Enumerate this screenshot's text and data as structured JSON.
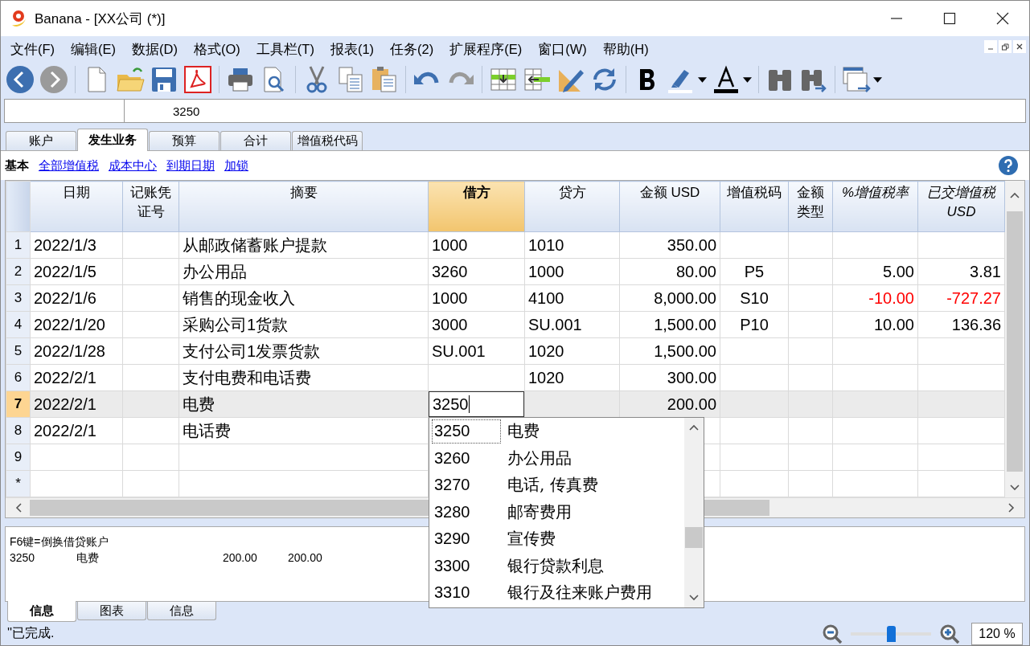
{
  "window": {
    "title": "Banana - [XX公司 (*)]"
  },
  "menu": [
    "文件(F)",
    "编辑(E)",
    "数据(D)",
    "格式(O)",
    "工具栏(T)",
    "报表(1)",
    "任务(2)",
    "扩展程序(E)",
    "窗口(W)",
    "帮助(H)"
  ],
  "formula_bar": {
    "value": "3250"
  },
  "tabs": [
    {
      "label": "账户",
      "selected": false
    },
    {
      "label": "发生业务",
      "selected": true
    },
    {
      "label": "预算",
      "selected": false
    },
    {
      "label": "合计",
      "selected": false
    },
    {
      "label": "增值税代码",
      "selected": false
    }
  ],
  "views": [
    {
      "label": "基本",
      "selected": true
    },
    {
      "label": "全部增值税",
      "selected": false
    },
    {
      "label": "成本中心",
      "selected": false
    },
    {
      "label": "到期日期",
      "selected": false
    },
    {
      "label": "加锁",
      "selected": false
    }
  ],
  "table": {
    "columns": [
      {
        "label": "日期",
        "kind": "text",
        "italic": false,
        "selected": false
      },
      {
        "label": "记账凭证号",
        "kind": "text",
        "italic": false,
        "selected": false
      },
      {
        "label": "摘要",
        "kind": "text",
        "italic": false,
        "selected": false
      },
      {
        "label": "借方",
        "kind": "text",
        "italic": false,
        "selected": true
      },
      {
        "label": "贷方",
        "kind": "text",
        "italic": false,
        "selected": false
      },
      {
        "label": "金额 USD",
        "kind": "amount",
        "italic": false,
        "selected": false
      },
      {
        "label": "增值税码",
        "kind": "code",
        "italic": false,
        "selected": false
      },
      {
        "label": "金额类型",
        "kind": "code",
        "italic": false,
        "selected": false
      },
      {
        "label": "%增值税率",
        "kind": "amount",
        "italic": true,
        "selected": false
      },
      {
        "label": "已交增值税 USD",
        "kind": "amount",
        "italic": true,
        "selected": false
      }
    ],
    "rows": [
      {
        "number": "1",
        "selected": false,
        "editing": false,
        "cells": [
          "2022/1/3",
          null,
          "从邮政储蓄账户提款",
          "1000",
          "1010",
          "350.00",
          null,
          null,
          null,
          null
        ]
      },
      {
        "number": "2",
        "selected": false,
        "editing": false,
        "negative": false,
        "cells": [
          "2022/1/5",
          null,
          "办公用品",
          "3260",
          "1000",
          "80.00",
          "P5",
          null,
          "5.00",
          "3.81"
        ]
      },
      {
        "number": "3",
        "selected": false,
        "editing": false,
        "negative": true,
        "cells": [
          "2022/1/6",
          null,
          "销售的现金收入",
          "1000",
          "4100",
          "8,000.00",
          "S10",
          null,
          "-10.00",
          "-727.27"
        ]
      },
      {
        "number": "4",
        "selected": false,
        "editing": false,
        "negative": false,
        "cells": [
          "2022/1/20",
          null,
          "采购公司1货款",
          "3000",
          "SU.001",
          "1,500.00",
          "P10",
          null,
          "10.00",
          "136.36"
        ]
      },
      {
        "number": "5",
        "selected": false,
        "editing": false,
        "cells": [
          "2022/1/28",
          null,
          "支付公司1发票货款",
          "SU.001",
          "1020",
          "1,500.00",
          null,
          null,
          null,
          null
        ]
      },
      {
        "number": "6",
        "selected": false,
        "editing": false,
        "cells": [
          "2022/2/1",
          null,
          "支付电费和电话费",
          null,
          "1020",
          "300.00",
          null,
          null,
          null,
          null
        ]
      },
      {
        "number": "7",
        "selected": true,
        "editing": true,
        "cells": [
          "2022/2/1",
          null,
          "电费",
          "3250",
          null,
          "200.00",
          null,
          null,
          null,
          null
        ]
      },
      {
        "number": "8",
        "selected": false,
        "editing": false,
        "cells": [
          "2022/2/1",
          null,
          "电话费",
          null,
          null,
          null,
          null,
          null,
          null,
          null
        ]
      },
      {
        "number": "9",
        "selected": false,
        "editing": false,
        "cells": [
          null,
          null,
          null,
          null,
          null,
          null,
          null,
          null,
          null,
          null
        ]
      },
      {
        "number": "*",
        "selected": false,
        "editing": false,
        "cells": [
          null,
          null,
          null,
          null,
          null,
          null,
          null,
          null,
          null,
          null
        ]
      }
    ]
  },
  "account_list": {
    "items": [
      {
        "code": "3250",
        "name": "电费",
        "selected": true
      },
      {
        "code": "3260",
        "name": "办公用品",
        "selected": false
      },
      {
        "code": "3270",
        "name": "电话, 传真费",
        "selected": false
      },
      {
        "code": "3280",
        "name": "邮寄费用",
        "selected": false
      },
      {
        "code": "3290",
        "name": "宣传费",
        "selected": false
      },
      {
        "code": "3300",
        "name": "银行贷款利息",
        "selected": false
      },
      {
        "code": "3310",
        "name": "银行及往来账户费用",
        "selected": false
      }
    ]
  },
  "info_panel": {
    "hint": "F6键=倒换借贷账户",
    "entry": [
      "3250",
      "电费",
      "200.00",
      "200.00"
    ]
  },
  "bottom_tabs": [
    {
      "label": "信息",
      "selected": true
    },
    {
      "label": "图表",
      "selected": false
    },
    {
      "label": "信息",
      "selected": false
    }
  ],
  "status_bar": {
    "text": "''已完成."
  },
  "zoom": {
    "level": 0.5,
    "value": "120 %"
  }
}
